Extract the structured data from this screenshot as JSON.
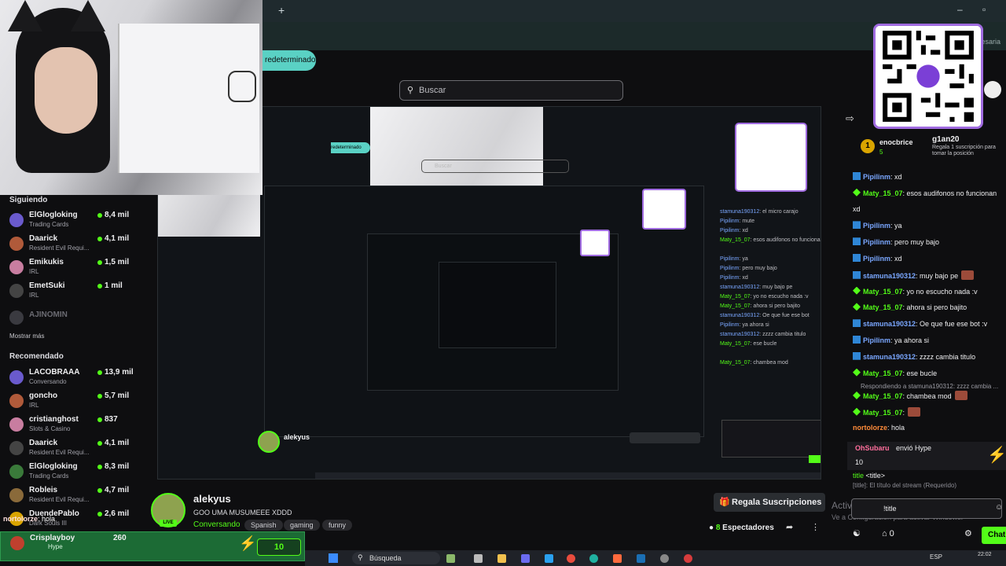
{
  "window": {
    "new_tab": "+",
    "minimize": "–",
    "maximize": "▫",
    "account_hint": "necesaria"
  },
  "header": {
    "default_pill": "redeterminado",
    "search_placeholder": "Buscar"
  },
  "sidebar": {
    "following_title": "Siguiendo",
    "following": [
      {
        "name": "ElGlogloking",
        "category": "Trading Cards",
        "viewers": "8,4 mil"
      },
      {
        "name": "Daarick",
        "category": "Resident Evil Requi...",
        "viewers": "4,1 mil"
      },
      {
        "name": "Emikukis",
        "category": "IRL",
        "viewers": "1,5 mil"
      },
      {
        "name": "EmetSuki",
        "category": "IRL",
        "viewers": "1 mil"
      }
    ],
    "offline": {
      "name": "AJINOMIN"
    },
    "show_more": "Mostrar más",
    "recommended_title": "Recomendado",
    "recommended": [
      {
        "name": "LACOBRAAA",
        "category": "Conversando",
        "viewers": "13,9 mil"
      },
      {
        "name": "goncho",
        "category": "IRL",
        "viewers": "5,7 mil"
      },
      {
        "name": "cristianghost",
        "category": "Slots & Casino",
        "viewers": "837"
      },
      {
        "name": "Daarick",
        "category": "Resident Evil Requi...",
        "viewers": "4,1 mil"
      },
      {
        "name": "ElGlogloking",
        "category": "Trading Cards",
        "viewers": "8,3 mil"
      },
      {
        "name": "Robleis",
        "category": "Resident Evil Requi...",
        "viewers": "4,7 mil"
      },
      {
        "name": "DuendePablo",
        "category": "Dark Souls III",
        "viewers": "2,6 mil"
      }
    ]
  },
  "stream": {
    "streamer": "alekyus",
    "live": "LIVE",
    "title": "GOO UMA MUSUMEEE XDDD",
    "category": "Conversando",
    "tags": [
      "Spanish",
      "gaming",
      "funny"
    ],
    "gift_button": "Regala Suscripciones",
    "viewers_count": "8",
    "viewers_label": "Espectadores"
  },
  "overlay": {
    "chat_line_user": "nortolorze",
    "chat_line_text": ": hola",
    "hype_user": "Crisplayboy",
    "hype_sub": "Hype",
    "hype_value": "260",
    "hype_count": "10"
  },
  "chat": {
    "pinned": {
      "user": "enocbrice",
      "value": "5",
      "gifter": "g1an20",
      "gift_desc": "Regala 1 suscripción para tomar la posición",
      "rank": "1"
    },
    "messages": [
      {
        "user": "Pipilinm",
        "text": ": xd",
        "color": "blue",
        "badge": "kick"
      },
      {
        "user": "Maty_15_07",
        "text": ": esos audifonos no funcionan",
        "color": "green",
        "badge": "gem"
      },
      {
        "user": "",
        "text": "xd",
        "color": "",
        "badge": ""
      },
      {
        "user": "Pipilinm",
        "text": ": ya",
        "color": "blue",
        "badge": "kick"
      },
      {
        "user": "Pipilinm",
        "text": ": pero muy bajo",
        "color": "blue",
        "badge": "kick"
      },
      {
        "user": "Pipilinm",
        "text": ": xd",
        "color": "blue",
        "badge": "kick"
      },
      {
        "user": "stamuna190312",
        "text": ": muy bajo pe",
        "color": "blue",
        "badge": "kick"
      },
      {
        "user": "Maty_15_07",
        "text": ": yo no escucho nada :v",
        "color": "green",
        "badge": "gem"
      },
      {
        "user": "Maty_15_07",
        "text": ": ahora si pero bajito",
        "color": "green",
        "badge": "gem"
      },
      {
        "user": "stamuna190312",
        "text": ": Oe que fue ese bot :v",
        "color": "blue",
        "badge": "kick"
      },
      {
        "user": "Pipilinm",
        "text": ": ya ahora si",
        "color": "blue",
        "badge": "kick"
      },
      {
        "user": "stamuna190312",
        "text": ": zzzz cambia titulo",
        "color": "blue",
        "badge": "kick"
      },
      {
        "user": "Maty_15_07",
        "text": ": ese bucle",
        "color": "green",
        "badge": "gem"
      }
    ],
    "reply_hint": "Respondiendo a stamuna190312: zzzz cambia ...",
    "after_reply": [
      {
        "user": "Maty_15_07",
        "text": ": chambea mod",
        "color": "green",
        "badge": "gem"
      },
      {
        "user": "Maty_15_07",
        "text": ":",
        "color": "green",
        "badge": "gem"
      },
      {
        "user": "nortolorze",
        "text": ": hola",
        "color": "orange",
        "badge": ""
      }
    ],
    "gift": {
      "user": "OhSubaru",
      "text": "envió Hype",
      "count": "10"
    },
    "command": {
      "name": "title",
      "arg": "<title>",
      "hint": "[title]: El título del stream",
      "hint2": "(Requerido)"
    },
    "input_value": "!title",
    "activate_1": "Activar Windows",
    "activate_2": "Ve a Configuración para activar Windows.",
    "footer_count": "0",
    "send_button": "Chat"
  },
  "taskbar": {
    "search": "Búsqueda",
    "lang": "ESP",
    "time": "22:02"
  },
  "colors": {
    "accent": "#53fc18",
    "teal": "#5ad1c4",
    "qr_border": "#a06be0"
  }
}
